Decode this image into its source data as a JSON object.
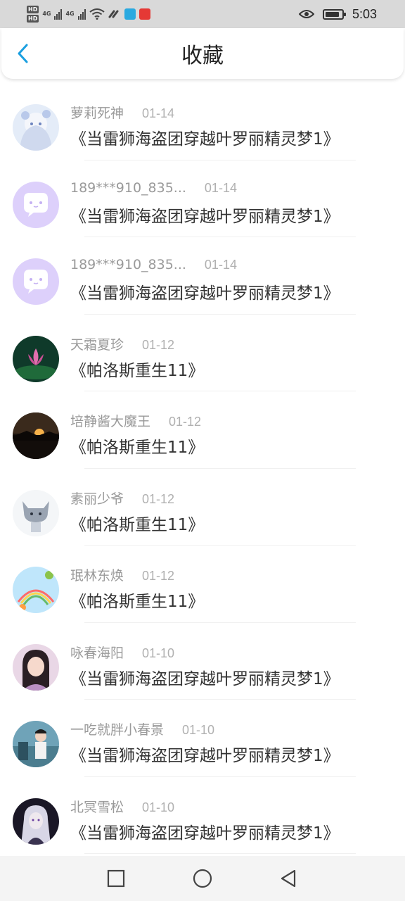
{
  "status_bar": {
    "hd1": "HD",
    "hd2": "HD",
    "net1": "4G",
    "net2": "4G",
    "time": "5:03",
    "icons": [
      "signal-icon",
      "wifi-icon",
      "app-icon",
      "eye-icon",
      "battery-icon"
    ]
  },
  "header": {
    "title": "收藏",
    "back_icon": "chevron-left-icon",
    "accent_color": "#1a9fe0"
  },
  "favorites": [
    {
      "user": "萝莉死神",
      "date": "01-14",
      "content": "《当雷狮海盗团穿越叶罗丽精灵梦1》",
      "avatar": "anime-girl-white"
    },
    {
      "user": "189***910_835...",
      "date": "01-14",
      "content": "《当雷狮海盗团穿越叶罗丽精灵梦1》",
      "avatar": "default-chat-purple"
    },
    {
      "user": "189***910_835...",
      "date": "01-14",
      "content": "《当雷狮海盗团穿越叶罗丽精灵梦1》",
      "avatar": "default-chat-purple"
    },
    {
      "user": "天霜夏珍",
      "date": "01-12",
      "content": "《帕洛斯重生11》",
      "avatar": "lotus"
    },
    {
      "user": "培静酱大魔王",
      "date": "01-12",
      "content": "《帕洛斯重生11》",
      "avatar": "sunset"
    },
    {
      "user": "素丽少爷",
      "date": "01-12",
      "content": "《帕洛斯重生11》",
      "avatar": "sketch-character"
    },
    {
      "user": "珉林东焕",
      "date": "01-12",
      "content": "《帕洛斯重生11》",
      "avatar": "rainbow-sky"
    },
    {
      "user": "咏春海阳",
      "date": "01-10",
      "content": "《当雷狮海盗团穿越叶罗丽精灵梦1》",
      "avatar": "girl-photo"
    },
    {
      "user": "一吃就胖小春景",
      "date": "01-10",
      "content": "《当雷狮海盗团穿越叶罗丽精灵梦1》",
      "avatar": "boy-photo"
    },
    {
      "user": "北冥雪松",
      "date": "01-10",
      "content": "《当雷狮海盗团穿越叶罗丽精灵梦1》",
      "avatar": "dark-anime"
    }
  ],
  "nav": {
    "icons": [
      "square-icon",
      "circle-icon",
      "triangle-back-icon"
    ]
  }
}
